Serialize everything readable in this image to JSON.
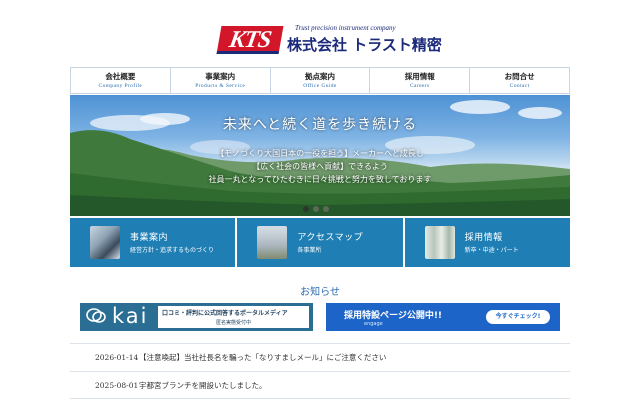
{
  "logo": {
    "mark": "KTS",
    "tagline": "Trust precision instrument company",
    "name": "株式会社 トラスト精密"
  },
  "nav": {
    "items": [
      {
        "label": "会社概要",
        "sub": "Company Profile"
      },
      {
        "label": "事業案内",
        "sub": "Products & Service"
      },
      {
        "label": "拠点案内",
        "sub": "Office Guide"
      },
      {
        "label": "採用情報",
        "sub": "Careers"
      },
      {
        "label": "お問合せ",
        "sub": "Contact"
      }
    ]
  },
  "hero": {
    "title": "未来へと続く道を歩き続ける",
    "lines": [
      "【モノづくり大国日本の一役を担う】メーカーへと成長し",
      "【広く社会の皆様へ貢献】できるよう",
      "社員一丸となってひたむきに日々挑戦と努力を致しております"
    ],
    "slide_count": 3,
    "active_slide": 1
  },
  "features": [
    {
      "title": "事業案内",
      "sub": "経営方針・追求するものづくり",
      "icon": "worker-photo"
    },
    {
      "title": "アクセスマップ",
      "sub": "各事業所",
      "icon": "building-photo"
    },
    {
      "title": "採用情報",
      "sub": "新卒・中途・パート",
      "icon": "staff-photo"
    }
  ],
  "news": {
    "heading": "お知らせ",
    "items": [
      {
        "date": "2026-01-14",
        "title": "【注意喚起】当社社長名を騙った「なりすましメール」にご注意ください"
      },
      {
        "date": "2025-08-01",
        "title": "宇都宮ブランチを開設いたしました。"
      }
    ]
  },
  "ads": {
    "kai": {
      "word": "kai",
      "line1": "口コミ・評判に公式回答するポータルメディア",
      "line2": "匿名実態受付中"
    },
    "recruit": {
      "title": "採用特設ページ公開中!!",
      "brand": "engage",
      "button": "今すぐチェック!"
    }
  },
  "colors": {
    "brand_red": "#d3172a",
    "brand_navy": "#1b2a7a",
    "feature_blue": "#1f7fb5",
    "link_blue": "#2b6cb0"
  }
}
